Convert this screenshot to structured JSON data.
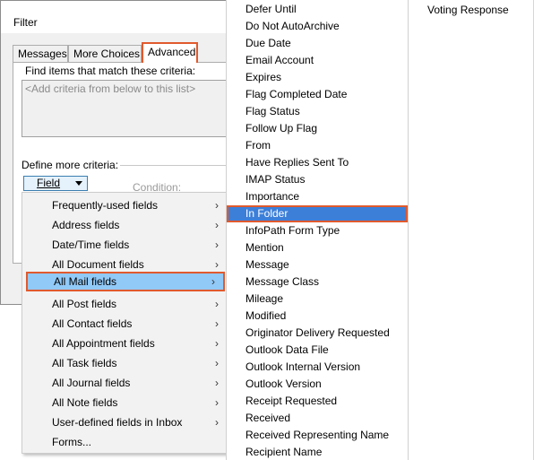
{
  "dialog": {
    "title": "Filter",
    "tabs": [
      {
        "label": "Messages"
      },
      {
        "label": "More Choices"
      },
      {
        "label": "Advanced"
      }
    ],
    "find_label": "Find items that match these criteria:",
    "criteria_placeholder": "<Add criteria from below to this list>",
    "define_label": "Define more criteria:",
    "field_button": "Field",
    "condition_label": "Condition:"
  },
  "field_menu": {
    "items": [
      {
        "label": "Frequently-used fields",
        "submenu": true
      },
      {
        "label": "Address fields",
        "submenu": true
      },
      {
        "label": "Date/Time fields",
        "submenu": true
      },
      {
        "label": "All Document fields",
        "submenu": true
      },
      {
        "label": "All Mail fields",
        "submenu": true,
        "highlighted": true
      },
      {
        "label": "All Post fields",
        "submenu": true
      },
      {
        "label": "All Contact fields",
        "submenu": true
      },
      {
        "label": "All Appointment fields",
        "submenu": true
      },
      {
        "label": "All Task fields",
        "submenu": true
      },
      {
        "label": "All Journal fields",
        "submenu": true
      },
      {
        "label": "All Note fields",
        "submenu": true
      },
      {
        "label": "User-defined fields in Inbox",
        "submenu": true
      },
      {
        "label": "Forms...",
        "submenu": false
      }
    ],
    "chevron": "›"
  },
  "mail_fields": {
    "items": [
      {
        "label": "Defer Until"
      },
      {
        "label": "Do Not AutoArchive"
      },
      {
        "label": "Due Date"
      },
      {
        "label": "Email Account"
      },
      {
        "label": "Expires"
      },
      {
        "label": "Flag Completed Date"
      },
      {
        "label": "Flag Status"
      },
      {
        "label": "Follow Up Flag"
      },
      {
        "label": "From"
      },
      {
        "label": "Have Replies Sent To"
      },
      {
        "label": "IMAP Status"
      },
      {
        "label": "Importance"
      },
      {
        "label": "In Folder",
        "highlighted": true
      },
      {
        "label": "InfoPath Form Type"
      },
      {
        "label": "Mention"
      },
      {
        "label": "Message"
      },
      {
        "label": "Message Class"
      },
      {
        "label": "Mileage"
      },
      {
        "label": "Modified"
      },
      {
        "label": "Originator Delivery Requested"
      },
      {
        "label": "Outlook Data File"
      },
      {
        "label": "Outlook Internal Version"
      },
      {
        "label": "Outlook Version"
      },
      {
        "label": "Receipt Requested"
      },
      {
        "label": "Received"
      },
      {
        "label": "Received Representing Name"
      },
      {
        "label": "Recipient Name"
      }
    ]
  },
  "mail_fields_col2": {
    "items": [
      {
        "label": "Voting Response"
      }
    ]
  },
  "colors": {
    "highlight_border": "#e05a2e",
    "menu_highlight": "#91c9f7",
    "selected_item": "#3c7fd9"
  }
}
